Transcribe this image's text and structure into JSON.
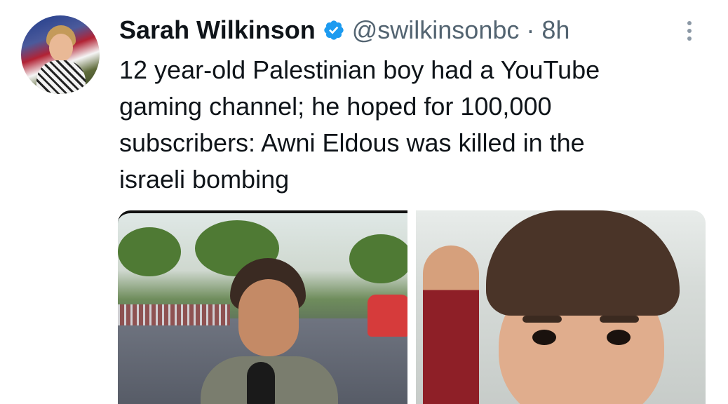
{
  "tweet": {
    "author_name": "Sarah Wilkinson",
    "handle": "@swilkinsonbc",
    "separator": "·",
    "time": "8h",
    "text": "12 year-old Palestinian boy had a YouTube\ngaming channel; he hoped for 100,000\nsubscribers: Awni Eldous was killed in the\nisraeli bombing"
  },
  "icons": {
    "verified": "verified-badge-icon",
    "more": "more-options-icon"
  },
  "colors": {
    "verified_blue": "#1d9bf0",
    "text": "#0f1419",
    "secondary_text": "#536471"
  }
}
